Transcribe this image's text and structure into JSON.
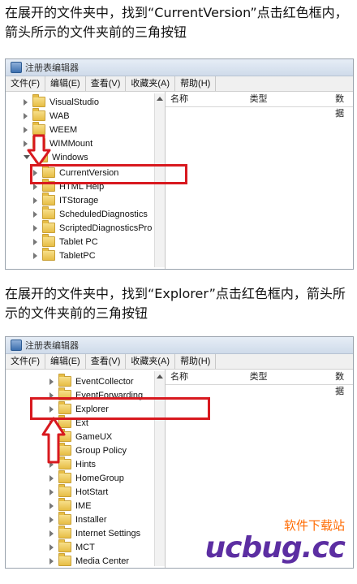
{
  "instructions": {
    "step1": "在展开的文件夹中，找到“CurrentVersion”点击红色框内，箭头所示的文件夹前的三角按钮",
    "step2": "在展开的文件夹中，找到“Explorer”点击红色框内，箭头所示的文件夹前的三角按钮"
  },
  "window": {
    "title": "注册表编辑器",
    "menu": [
      "文件(F)",
      "编辑(E)",
      "查看(V)",
      "收藏夹(A)",
      "帮助(H)"
    ],
    "columns": [
      "名称",
      "类型",
      "数据"
    ]
  },
  "tree1": [
    {
      "label": "VisualStudio"
    },
    {
      "label": "WAB"
    },
    {
      "label": "WEEM"
    },
    {
      "label": "WIMMount"
    },
    {
      "label": "Windows"
    },
    {
      "label": "CurrentVersion"
    },
    {
      "label": "HTML Help"
    },
    {
      "label": "ITStorage"
    },
    {
      "label": "ScheduledDiagnostics"
    },
    {
      "label": "ScriptedDiagnosticsPro"
    },
    {
      "label": "Tablet PC"
    },
    {
      "label": "TabletPC"
    }
  ],
  "tree2": [
    {
      "label": "EventCollector"
    },
    {
      "label": "EventForwarding"
    },
    {
      "label": "Explorer"
    },
    {
      "label": "Ext"
    },
    {
      "label": "GameUX"
    },
    {
      "label": "Group Policy"
    },
    {
      "label": "Hints"
    },
    {
      "label": "HomeGroup"
    },
    {
      "label": "HotStart"
    },
    {
      "label": "IME"
    },
    {
      "label": "Installer"
    },
    {
      "label": "Internet Settings"
    },
    {
      "label": "MCT"
    },
    {
      "label": "Media Center"
    }
  ],
  "watermark": {
    "brand": "ucbug.cc",
    "tagline": "软件下载站"
  },
  "colors": {
    "highlight_red": "#d8191f",
    "watermark_purple": "#5c2ea2",
    "watermark_orange": "#ff6a00"
  }
}
